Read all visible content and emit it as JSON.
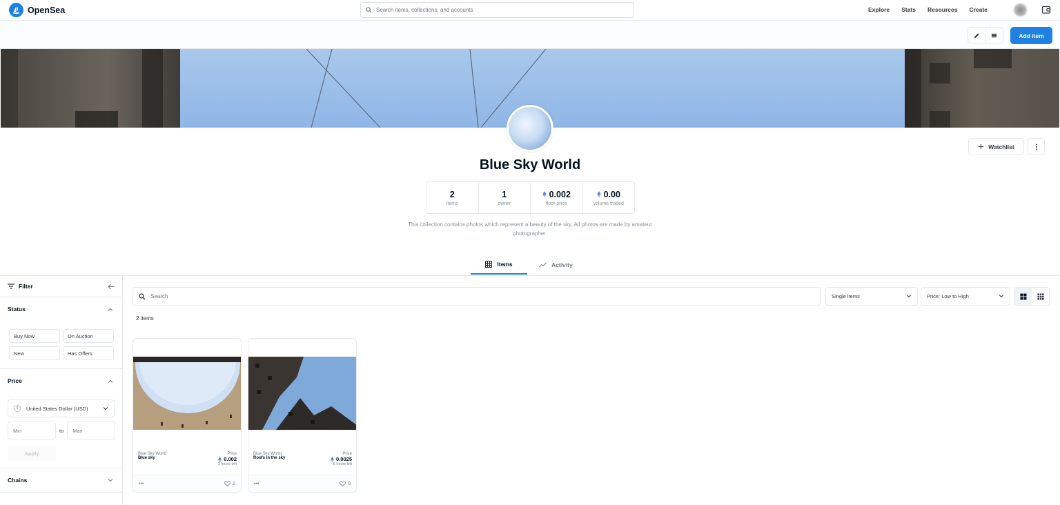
{
  "app": {
    "name": "OpenSea"
  },
  "search": {
    "placeholder": "Search items, collections, and accounts"
  },
  "nav": {
    "links": [
      "Explore",
      "Stats",
      "Resources",
      "Create"
    ]
  },
  "owner_toolbar": {
    "add_item_label": "Add item",
    "icons": [
      "pencil-icon",
      "list-icon"
    ]
  },
  "collection": {
    "title": "Blue Sky World",
    "watchlist_label": "Watchlist",
    "stats": [
      {
        "value": "2",
        "label": "items",
        "eth": false
      },
      {
        "value": "1",
        "label": "owner",
        "eth": false
      },
      {
        "value": "0.002",
        "label": "floor price",
        "eth": true
      },
      {
        "value": "0.00",
        "label": "volume traded",
        "eth": true
      }
    ],
    "description": "This collection contains photos which represent a beauty of the sky. All photos are made by amateur photographer."
  },
  "tabs": [
    {
      "label": "Items",
      "active": true
    },
    {
      "label": "Activity",
      "active": false
    }
  ],
  "sidebar": {
    "filter_label": "Filter",
    "status": {
      "title": "Status",
      "options": [
        "Buy Now",
        "On Auction",
        "New",
        "Has Offers"
      ]
    },
    "price": {
      "title": "Price",
      "currency": "United States Dollar (USD)",
      "currency_symbol": "$",
      "min_placeholder": "Min",
      "to_label": "to",
      "max_placeholder": "Max",
      "apply_label": "Apply"
    },
    "chains": {
      "title": "Chains"
    }
  },
  "main": {
    "search_placeholder": "Search",
    "type_select": "Single items",
    "sort_select": "Price: Low to High",
    "count_label": "2 items",
    "items": [
      {
        "collection": "Blue Sky World",
        "name": "Blue sky",
        "price_label": "Price",
        "price": "0.002",
        "time_left": "3 hours left",
        "likes": "2"
      },
      {
        "collection": "Blue Sky World",
        "name": "Roofs in the sky",
        "price_label": "Price",
        "price": "0.0025",
        "time_left": "5 hours left",
        "likes": "0"
      }
    ]
  },
  "colors": {
    "accent": "#2081e2",
    "eth": "#627eea"
  }
}
